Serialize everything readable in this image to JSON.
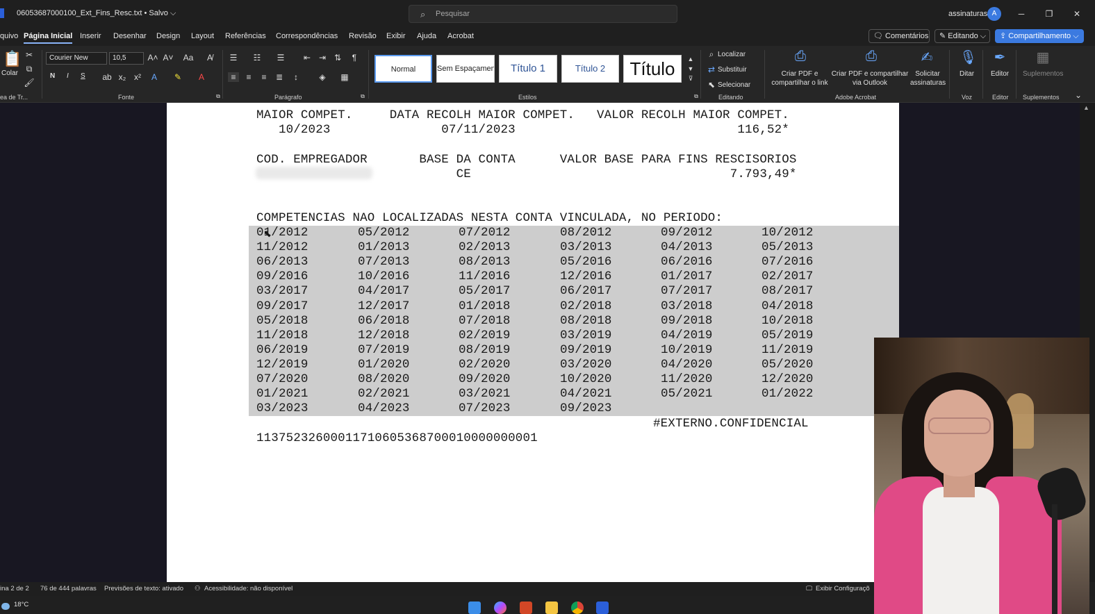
{
  "titlebar": {
    "doc_title": "06053687000100_Ext_Fins_Resc.txt • Salvo ⌵",
    "search_placeholder": "Pesquisar",
    "account_name": "assinaturas",
    "avatar_initial": "A"
  },
  "menu": {
    "tabs": [
      "quivo",
      "Página Inicial",
      "Inserir",
      "Desenhar",
      "Design",
      "Layout",
      "Referências",
      "Correspondências",
      "Revisão",
      "Exibir",
      "Ajuda",
      "Acrobat"
    ],
    "active_tab": "Página Inicial",
    "comments_label": "Comentários",
    "editing_label": "Editando ⌵",
    "share_label": "Compartilhamento ⌵"
  },
  "ribbon": {
    "clipboard": {
      "paste_label": "Colar",
      "group_label": "ea de Tr..."
    },
    "font": {
      "font_name": "Courier New",
      "font_size": "10,5",
      "bold": "N",
      "italic": "I",
      "underline": "S",
      "group_label": "Fonte"
    },
    "paragraph": {
      "group_label": "Parágrafo"
    },
    "styles": {
      "items": [
        "Normal",
        "Sem Espaçamen",
        "Título 1",
        "Título 2",
        "Título"
      ],
      "group_label": "Estilos"
    },
    "editing": {
      "find": "Localizar",
      "replace": "Substituir",
      "select": "Selecionar",
      "group_label": "Editando"
    },
    "acrobat": {
      "create_pdf_link": "Criar PDF e compartilhar o link",
      "create_pdf_outlook": "Criar PDF e compartilhar via Outlook",
      "request_signatures": "Solicitar assinaturas",
      "group_label": "Adobe Acrobat"
    },
    "voice": {
      "dictate": "Ditar",
      "group_label": "Voz"
    },
    "editor": {
      "editor": "Editor",
      "group_label": "Editor"
    },
    "addins": {
      "addins": "Suplementos",
      "group_label": "Suplementos"
    }
  },
  "document": {
    "lines": [
      "MAIOR COMPET.     DATA RECOLH MAIOR COMPET.   VALOR RECOLH MAIOR COMPET.",
      "   10/2023               07/11/2023                              116,52*",
      "COD. EMPREGADOR       BASE DA CONTA      VALOR BASE PARA FINS RESCISORIOS",
      "                           CE                                   7.793,49*",
      "COMPETENCIAS NAO LOCALIZADAS NESTA CONTA VINCULADA, NO PERIODO:"
    ],
    "competencias": [
      [
        "01/2012",
        "05/2012",
        "07/2012",
        "08/2012",
        "09/2012",
        "10/2012"
      ],
      [
        "11/2012",
        "01/2013",
        "02/2013",
        "03/2013",
        "04/2013",
        "05/2013"
      ],
      [
        "06/2013",
        "07/2013",
        "08/2013",
        "05/2016",
        "06/2016",
        "07/2016"
      ],
      [
        "09/2016",
        "10/2016",
        "11/2016",
        "12/2016",
        "01/2017",
        "02/2017"
      ],
      [
        "03/2017",
        "04/2017",
        "05/2017",
        "06/2017",
        "07/2017",
        "08/2017"
      ],
      [
        "09/2017",
        "12/2017",
        "01/2018",
        "02/2018",
        "03/2018",
        "04/2018"
      ],
      [
        "05/2018",
        "06/2018",
        "07/2018",
        "08/2018",
        "09/2018",
        "10/2018"
      ],
      [
        "11/2018",
        "12/2018",
        "02/2019",
        "03/2019",
        "04/2019",
        "05/2019"
      ],
      [
        "06/2019",
        "07/2019",
        "08/2019",
        "09/2019",
        "10/2019",
        "11/2019"
      ],
      [
        "12/2019",
        "01/2020",
        "02/2020",
        "03/2020",
        "04/2020",
        "05/2020"
      ],
      [
        "07/2020",
        "08/2020",
        "09/2020",
        "10/2020",
        "11/2020",
        "12/2020"
      ],
      [
        "01/2021",
        "02/2021",
        "03/2021",
        "04/2021",
        "05/2021",
        "01/2022"
      ],
      [
        "03/2023",
        "04/2023",
        "07/2023",
        "09/2023"
      ]
    ],
    "confidential": "#EXTERNO.CONFIDENCIAL",
    "barcode_number": "11375232600011710605368700010000000001"
  },
  "statusbar": {
    "page": "ina 2 de 2",
    "words": "76 de 444 palavras",
    "text_predictions": "Previsões de texto: ativado",
    "accessibility": "Acessibilidade: não disponível",
    "display_settings": "Exibir Configuraçõ"
  },
  "taskbar": {
    "temperature": "18°C"
  },
  "colors": {
    "accent": "#3b7ae0",
    "selection": "#cdcdcd",
    "ribbon_bg": "#262626"
  }
}
